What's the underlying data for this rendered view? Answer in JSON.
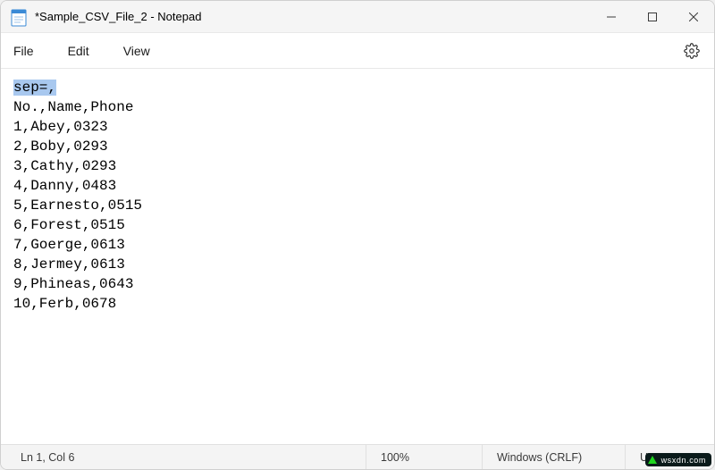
{
  "window": {
    "title": "*Sample_CSV_File_2 - Notepad"
  },
  "menu": {
    "file": "File",
    "edit": "Edit",
    "view": "View"
  },
  "editor": {
    "selected_line": "sep=,",
    "lines": [
      "No.,Name,Phone",
      "1,Abey,0323",
      "2,Boby,0293",
      "3,Cathy,0293",
      "4,Danny,0483",
      "5,Earnesto,0515",
      "6,Forest,0515",
      "7,Goerge,0613",
      "8,Jermey,0613",
      "9,Phineas,0643",
      "10,Ferb,0678"
    ]
  },
  "status": {
    "cursor": "Ln 1, Col 6",
    "zoom": "100%",
    "eol": "Windows (CRLF)",
    "encoding": "UTF-8"
  },
  "watermark": "wsxdn.com"
}
